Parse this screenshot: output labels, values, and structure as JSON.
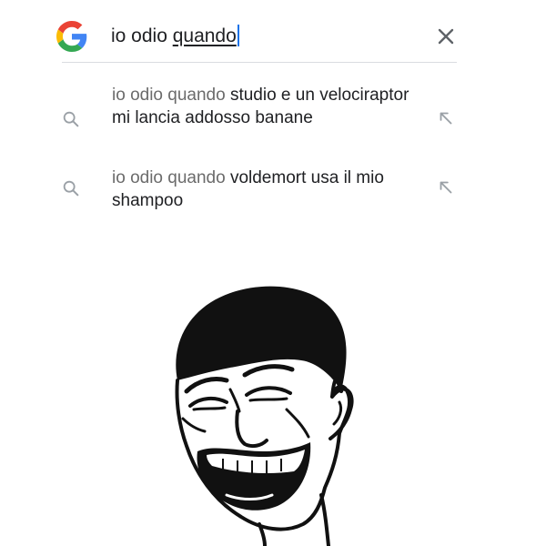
{
  "search": {
    "typed_prefix": "io odio ",
    "typed_word": "quando"
  },
  "suggestions": [
    {
      "prefix": "io odio quando",
      "completion": " studio e un velociraptor mi lancia addosso banane"
    },
    {
      "prefix": "io odio quando",
      "completion": " voldemort usa il mio shampoo"
    }
  ],
  "icons": {
    "logo": "google-g-icon",
    "clear": "close-icon",
    "suggestion": "search-icon",
    "fill": "arrow-up-left-icon"
  },
  "colors": {
    "google_blue": "#4285F4",
    "google_red": "#EA4335",
    "google_yellow": "#FBBC05",
    "google_green": "#34A853",
    "caret": "#1a73e8"
  }
}
